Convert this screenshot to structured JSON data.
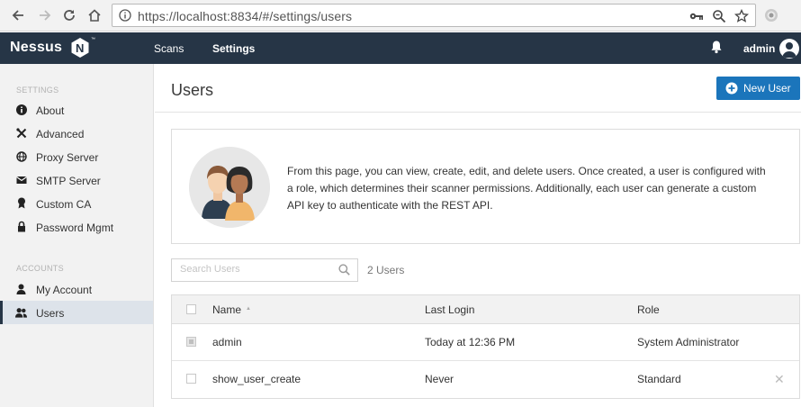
{
  "browser": {
    "url": "https://localhost:8834/#/settings/users"
  },
  "header": {
    "logo": "Nessus",
    "logo_badge": "N",
    "trademark": "™",
    "nav": [
      {
        "label": "Scans"
      },
      {
        "label": "Settings"
      }
    ],
    "user": "admin"
  },
  "sidebar": {
    "settings_heading": "SETTINGS",
    "settings_items": [
      {
        "label": "About",
        "icon": "info-icon"
      },
      {
        "label": "Advanced",
        "icon": "tools-icon"
      },
      {
        "label": "Proxy Server",
        "icon": "globe-icon"
      },
      {
        "label": "SMTP Server",
        "icon": "mail-icon"
      },
      {
        "label": "Custom CA",
        "icon": "certificate-icon"
      },
      {
        "label": "Password Mgmt",
        "icon": "lock-icon"
      }
    ],
    "accounts_heading": "ACCOUNTS",
    "accounts_items": [
      {
        "label": "My Account",
        "icon": "user-icon"
      },
      {
        "label": "Users",
        "icon": "users-icon"
      }
    ]
  },
  "main": {
    "title": "Users",
    "new_user_button": "New User",
    "info_text": "From this page, you can view, create, edit, and delete users. Once created, a user is configured with a role, which determines their scanner permissions. Additionally, each user can generate a custom API key to authenticate with the REST API.",
    "search_placeholder": "Search Users",
    "user_count": "2 Users",
    "table": {
      "columns": [
        "Name",
        "Last Login",
        "Role"
      ],
      "rows": [
        {
          "name": "admin",
          "last_login": "Today at 12:36 PM",
          "role": "System Administrator"
        },
        {
          "name": "show_user_create",
          "last_login": "Never",
          "role": "Standard"
        }
      ]
    }
  },
  "colors": {
    "header_bg": "#263546",
    "accent": "#1b75bb",
    "sidebar_bg": "#f2f2f2"
  }
}
